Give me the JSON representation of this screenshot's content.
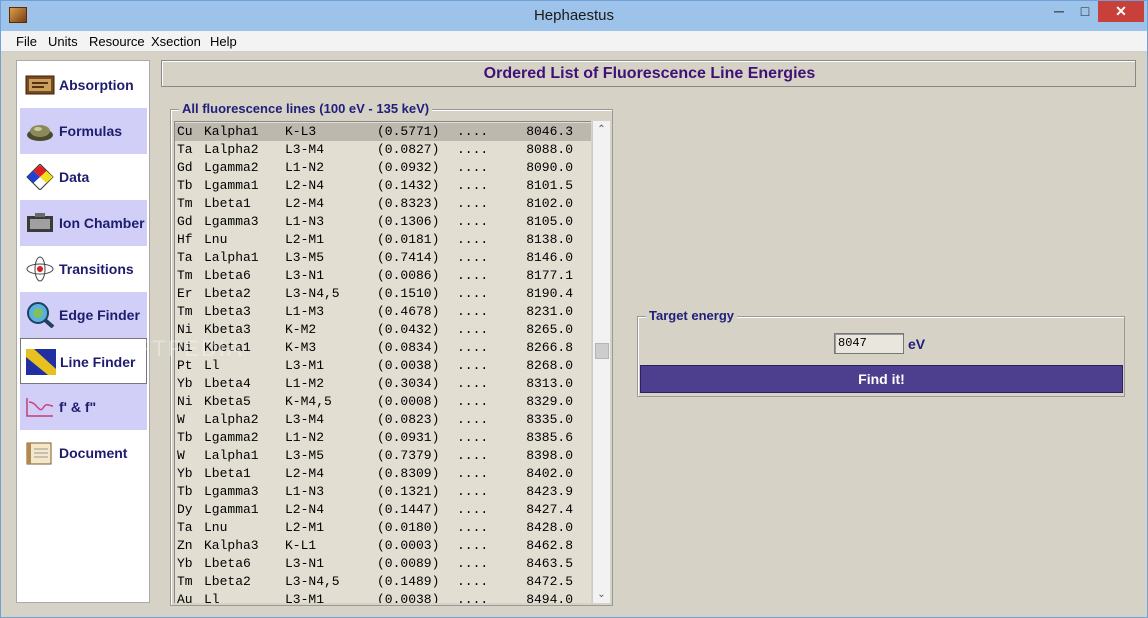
{
  "window": {
    "title": "Hephaestus"
  },
  "title_controls": {
    "minimize": "─",
    "maximize": "□",
    "close": "✕"
  },
  "menu": [
    "File",
    "Units",
    "Resource",
    "Xsection",
    "Help"
  ],
  "sidebar": {
    "items": [
      {
        "label": "Absorption",
        "icon": "absorption-icon"
      },
      {
        "label": "Formulas",
        "icon": "formulas-icon"
      },
      {
        "label": "Data",
        "icon": "data-icon"
      },
      {
        "label": "Ion Chamber",
        "icon": "ion-chamber-icon"
      },
      {
        "label": "Transitions",
        "icon": "transitions-icon"
      },
      {
        "label": "Edge Finder",
        "icon": "edge-finder-icon"
      },
      {
        "label": "Line Finder",
        "icon": "line-finder-icon"
      },
      {
        "label": "f' & f\"",
        "icon": "anomalous-scattering-icon"
      },
      {
        "label": "Document",
        "icon": "document-icon"
      }
    ],
    "active": "Line Finder"
  },
  "main": {
    "title": "Ordered List of Fluorescence Line Energies"
  },
  "lines_panel": {
    "legend": "All fluorescence lines (100 eV - 135 keV)",
    "rows": [
      {
        "el": "Cu",
        "line": "Kalpha1",
        "trans": "K-L3",
        "intensity": "(0.5771)",
        "dots": "....",
        "energy": "8046.3"
      },
      {
        "el": "Ta",
        "line": "Lalpha2",
        "trans": "L3-M4",
        "intensity": "(0.0827)",
        "dots": "....",
        "energy": "8088.0"
      },
      {
        "el": "Gd",
        "line": "Lgamma2",
        "trans": "L1-N2",
        "intensity": "(0.0932)",
        "dots": "....",
        "energy": "8090.0"
      },
      {
        "el": "Tb",
        "line": "Lgamma1",
        "trans": "L2-N4",
        "intensity": "(0.1432)",
        "dots": "....",
        "energy": "8101.5"
      },
      {
        "el": "Tm",
        "line": "Lbeta1",
        "trans": "L2-M4",
        "intensity": "(0.8323)",
        "dots": "....",
        "energy": "8102.0"
      },
      {
        "el": "Gd",
        "line": "Lgamma3",
        "trans": "L1-N3",
        "intensity": "(0.1306)",
        "dots": "....",
        "energy": "8105.0"
      },
      {
        "el": "Hf",
        "line": "Lnu",
        "trans": "L2-M1",
        "intensity": "(0.0181)",
        "dots": "....",
        "energy": "8138.0"
      },
      {
        "el": "Ta",
        "line": "Lalpha1",
        "trans": "L3-M5",
        "intensity": "(0.7414)",
        "dots": "....",
        "energy": "8146.0"
      },
      {
        "el": "Tm",
        "line": "Lbeta6",
        "trans": "L3-N1",
        "intensity": "(0.0086)",
        "dots": "....",
        "energy": "8177.1"
      },
      {
        "el": "Er",
        "line": "Lbeta2",
        "trans": "L3-N4,5",
        "intensity": "(0.1510)",
        "dots": "....",
        "energy": "8190.4"
      },
      {
        "el": "Tm",
        "line": "Lbeta3",
        "trans": "L1-M3",
        "intensity": "(0.4678)",
        "dots": "....",
        "energy": "8231.0"
      },
      {
        "el": "Ni",
        "line": "Kbeta3",
        "trans": "K-M2",
        "intensity": "(0.0432)",
        "dots": "....",
        "energy": "8265.0"
      },
      {
        "el": "Ni",
        "line": "Kbeta1",
        "trans": "K-M3",
        "intensity": "(0.0834)",
        "dots": "....",
        "energy": "8266.8"
      },
      {
        "el": "Pt",
        "line": "Ll",
        "trans": "L3-M1",
        "intensity": "(0.0038)",
        "dots": "....",
        "energy": "8268.0"
      },
      {
        "el": "Yb",
        "line": "Lbeta4",
        "trans": "L1-M2",
        "intensity": "(0.3034)",
        "dots": "....",
        "energy": "8313.0"
      },
      {
        "el": "Ni",
        "line": "Kbeta5",
        "trans": "K-M4,5",
        "intensity": "(0.0008)",
        "dots": "....",
        "energy": "8329.0"
      },
      {
        "el": "W",
        "line": "Lalpha2",
        "trans": "L3-M4",
        "intensity": "(0.0823)",
        "dots": "....",
        "energy": "8335.0"
      },
      {
        "el": "Tb",
        "line": "Lgamma2",
        "trans": "L1-N2",
        "intensity": "(0.0931)",
        "dots": "....",
        "energy": "8385.6"
      },
      {
        "el": "W",
        "line": "Lalpha1",
        "trans": "L3-M5",
        "intensity": "(0.7379)",
        "dots": "....",
        "energy": "8398.0"
      },
      {
        "el": "Yb",
        "line": "Lbeta1",
        "trans": "L2-M4",
        "intensity": "(0.8309)",
        "dots": "....",
        "energy": "8402.0"
      },
      {
        "el": "Tb",
        "line": "Lgamma3",
        "trans": "L1-N3",
        "intensity": "(0.1321)",
        "dots": "....",
        "energy": "8423.9"
      },
      {
        "el": "Dy",
        "line": "Lgamma1",
        "trans": "L2-N4",
        "intensity": "(0.1447)",
        "dots": "....",
        "energy": "8427.4"
      },
      {
        "el": "Ta",
        "line": "Lnu",
        "trans": "L2-M1",
        "intensity": "(0.0180)",
        "dots": "....",
        "energy": "8428.0"
      },
      {
        "el": "Zn",
        "line": "Kalpha3",
        "trans": "K-L1",
        "intensity": "(0.0003)",
        "dots": "....",
        "energy": "8462.8"
      },
      {
        "el": "Yb",
        "line": "Lbeta6",
        "trans": "L3-N1",
        "intensity": "(0.0089)",
        "dots": "....",
        "energy": "8463.5"
      },
      {
        "el": "Tm",
        "line": "Lbeta2",
        "trans": "L3-N4,5",
        "intensity": "(0.1489)",
        "dots": "....",
        "energy": "8472.5"
      },
      {
        "el": "Au",
        "line": "Ll",
        "trans": "L3-M1",
        "intensity": "(0.0038)",
        "dots": "....",
        "energy": "8494.0"
      }
    ]
  },
  "scrollbar": {
    "up": "⌃",
    "down": "⌄"
  },
  "target": {
    "legend": "Target energy",
    "value": "8047",
    "unit": "eV",
    "button": "Find it!"
  },
  "watermark": "SOFTPEDIA"
}
